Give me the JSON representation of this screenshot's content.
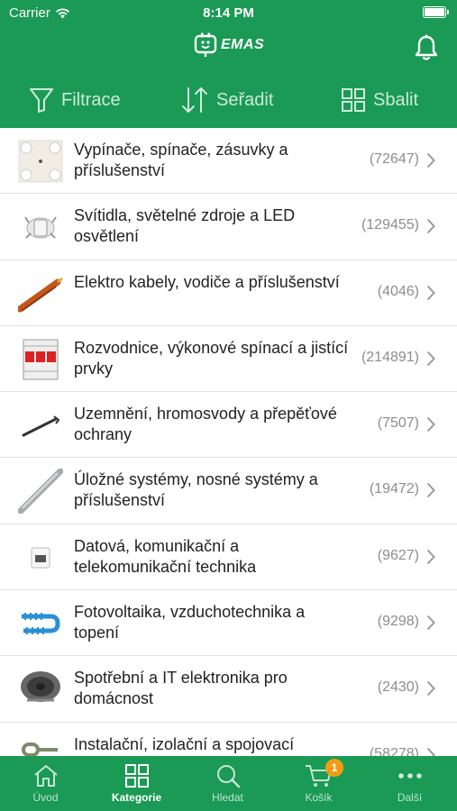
{
  "status_bar": {
    "carrier": "Carrier",
    "time": "8:14 PM"
  },
  "header": {
    "logo_text": "EMAS"
  },
  "toolbar": {
    "filter_label": "Filtrace",
    "sort_label": "Seřadit",
    "collapse_label": "Sbalit"
  },
  "categories": [
    {
      "title": "Vypínače, spínače, zásuvky a příslušenství",
      "count": "(72647)",
      "icon": "socket-icon"
    },
    {
      "title": "Svítidla, světelné zdroje a LED osvětlení",
      "count": "(129455)",
      "icon": "lamp-icon"
    },
    {
      "title": "Elektro kabely, vodiče a příslušenství",
      "count": "(4046)",
      "icon": "cable-icon"
    },
    {
      "title": "Rozvodnice, výkonové spínací a jistící prvky",
      "count": "(214891)",
      "icon": "circuit-breaker-icon"
    },
    {
      "title": "Uzemnění, hromosvody a přepěťové ochrany",
      "count": "(7507)",
      "icon": "grounding-rod-icon"
    },
    {
      "title": "Úložné systémy, nosné systémy a příslušenství",
      "count": "(19472)",
      "icon": "conduit-icon"
    },
    {
      "title": "Datová, komunikační a telekomunikační technika",
      "count": "(9627)",
      "icon": "data-socket-icon"
    },
    {
      "title": "Fotovoltaika, vzduchotechnika a topení",
      "count": "(9298)",
      "icon": "heating-cable-icon"
    },
    {
      "title": "Spotřební a IT elektronika pro domácnost",
      "count": "(2430)",
      "icon": "speaker-icon"
    },
    {
      "title": "Instalační, izolační a spojovací",
      "count": "(58278)",
      "icon": "clamp-icon"
    }
  ],
  "tabbar": {
    "home_label": "Úvod",
    "categories_label": "Kategorie",
    "search_label": "Hledat",
    "cart_label": "Košík",
    "cart_badge": "1",
    "more_label": "Další"
  },
  "colors": {
    "brand": "#1a9a55",
    "badge": "#f39c12"
  }
}
